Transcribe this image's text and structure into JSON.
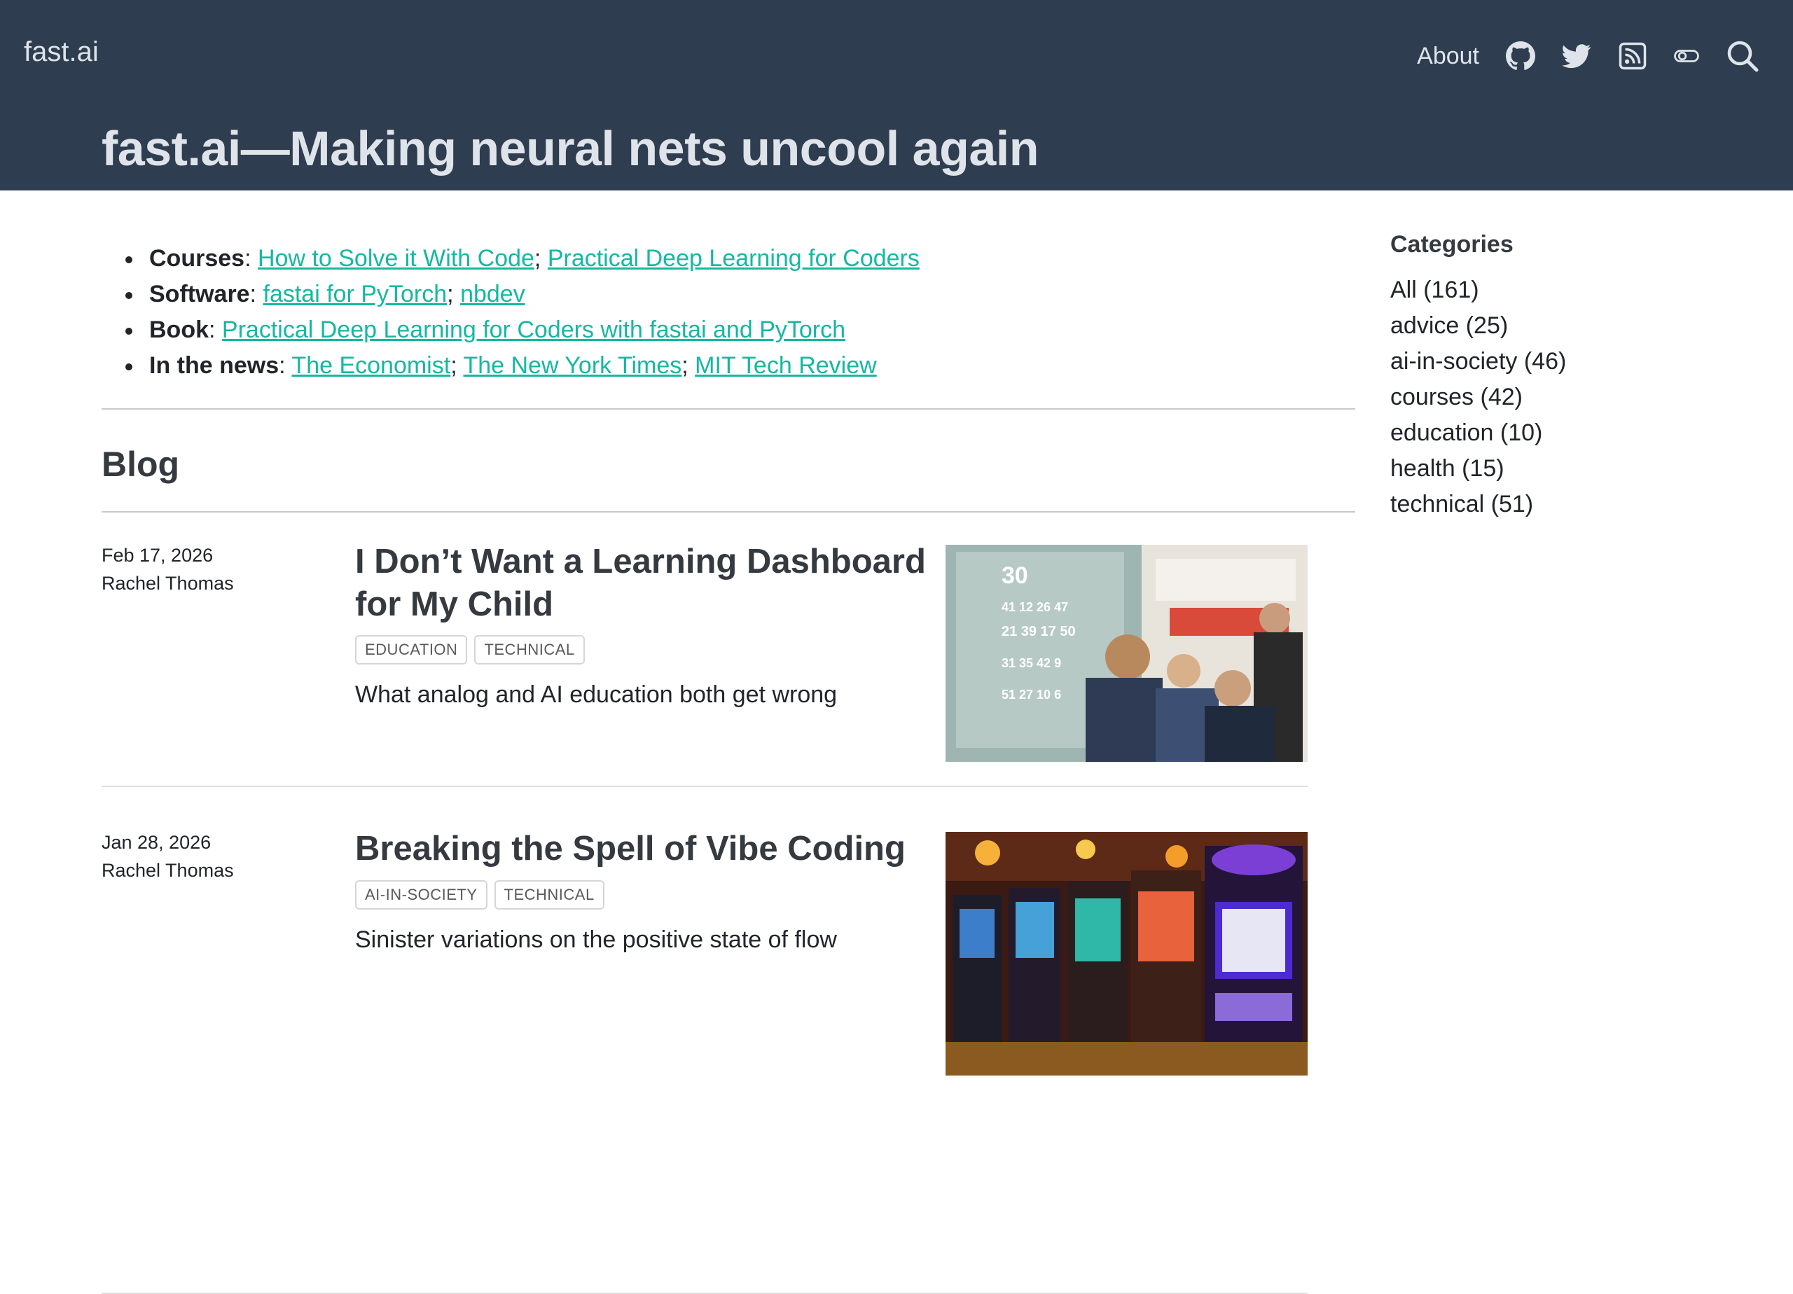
{
  "header": {
    "brand": "fast.ai",
    "nav": {
      "about": "About"
    },
    "icons": [
      "github-icon",
      "twitter-icon",
      "rss-icon",
      "toggle-icon",
      "search-icon"
    ],
    "title": "fast.ai—Making neural nets uncool again",
    "bg_color": "#2e3d4f"
  },
  "intro": {
    "courses": {
      "label": "Courses",
      "links": [
        "How to Solve it With Code",
        "Practical Deep Learning for Coders"
      ]
    },
    "software": {
      "label": "Software",
      "links": [
        "fastai for PyTorch",
        "nbdev"
      ]
    },
    "book": {
      "label": "Book",
      "links": [
        "Practical Deep Learning for Coders with fastai and PyTorch"
      ]
    },
    "news": {
      "label": "In the news",
      "links": [
        "The Economist",
        "The New York Times",
        "MIT Tech Review"
      ]
    },
    "link_color": "#14b8a0"
  },
  "blog": {
    "heading": "Blog",
    "posts": [
      {
        "date": "Feb 17, 2026",
        "author": "Rachel Thomas",
        "title": "I Don’t Want a Learning Dashboard for My Child",
        "tags": [
          "EDUCATION",
          "TECHNICAL"
        ],
        "description": "What analog and AI education both get wrong"
      },
      {
        "date": "Jan 28, 2026",
        "author": "Rachel Thomas",
        "title": "Breaking the Spell of Vibe Coding",
        "tags": [
          "AI-IN-SOCIETY",
          "TECHNICAL"
        ],
        "description": "Sinister variations on the positive state of flow"
      }
    ]
  },
  "sidebar": {
    "title": "Categories",
    "categories": [
      "All (161)",
      "advice (25)",
      "ai-in-society (46)",
      "courses (42)",
      "education (10)",
      "health (15)",
      "technical (51)"
    ]
  }
}
